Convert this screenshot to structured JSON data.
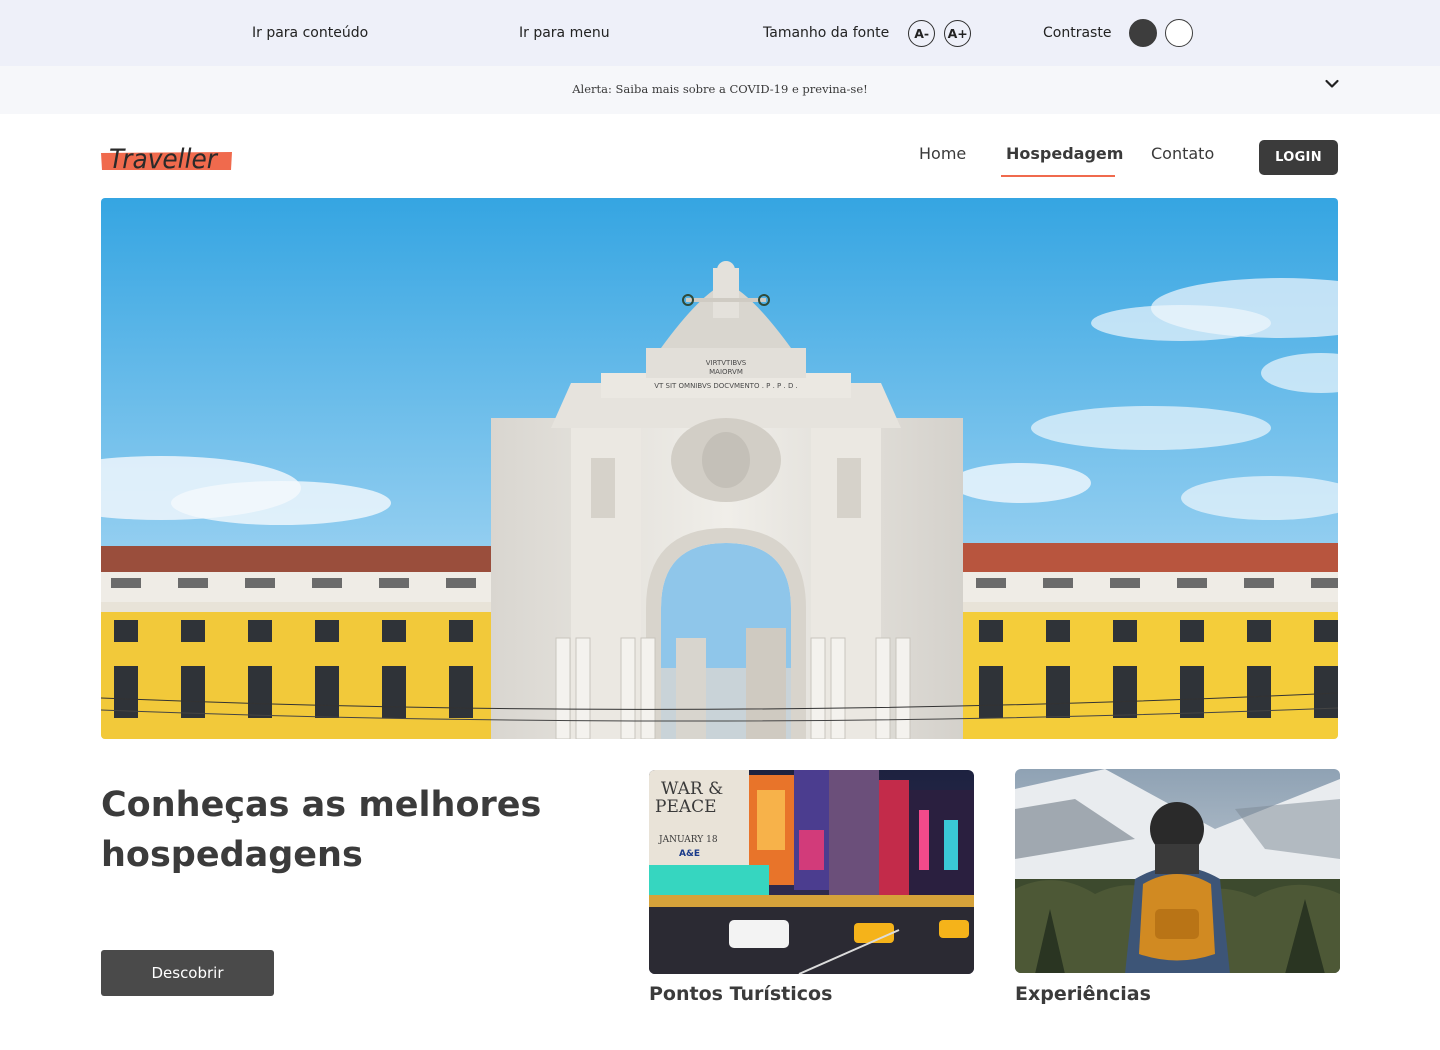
{
  "accessibility": {
    "skip_content": "Ir para conteúdo",
    "skip_menu": "Ir para menu",
    "font_size_label": "Tamanho da fonte",
    "font_decrease": "A-",
    "font_increase": "A+",
    "contrast_label": "Contraste"
  },
  "alert": {
    "text": "Alerta: Saiba mais sobre a COVID-19 e previna-se!",
    "toggle_icon": "chevron-down-icon"
  },
  "header": {
    "logo_text": "Traveller",
    "nav": [
      {
        "label": "Home",
        "active": false
      },
      {
        "label": "Hospedagem",
        "active": true
      },
      {
        "label": "Contato",
        "active": false
      }
    ],
    "login_label": "LOGIN"
  },
  "hero": {
    "inscriptions": [
      "VIRTVTIBVS",
      "MAIORVM",
      "VT SIT OMNIBVS DOCVMENTO . P . P . D ."
    ]
  },
  "main": {
    "headline_line1": "Conheças as melhores",
    "headline_line2": "hospedagens",
    "cta_label": "Descobrir",
    "cards": [
      {
        "title": "Pontos Turísticos",
        "billboards": [
          "WAR &",
          "PEACE",
          "JANUARY 18",
          "A&E"
        ]
      },
      {
        "title": "Experiências"
      }
    ]
  },
  "colors": {
    "accent": "#f06a4d",
    "dark": "#3b3b3b",
    "a11y_bg": "#eef0f9",
    "alert_bg": "#f6f7fa"
  }
}
